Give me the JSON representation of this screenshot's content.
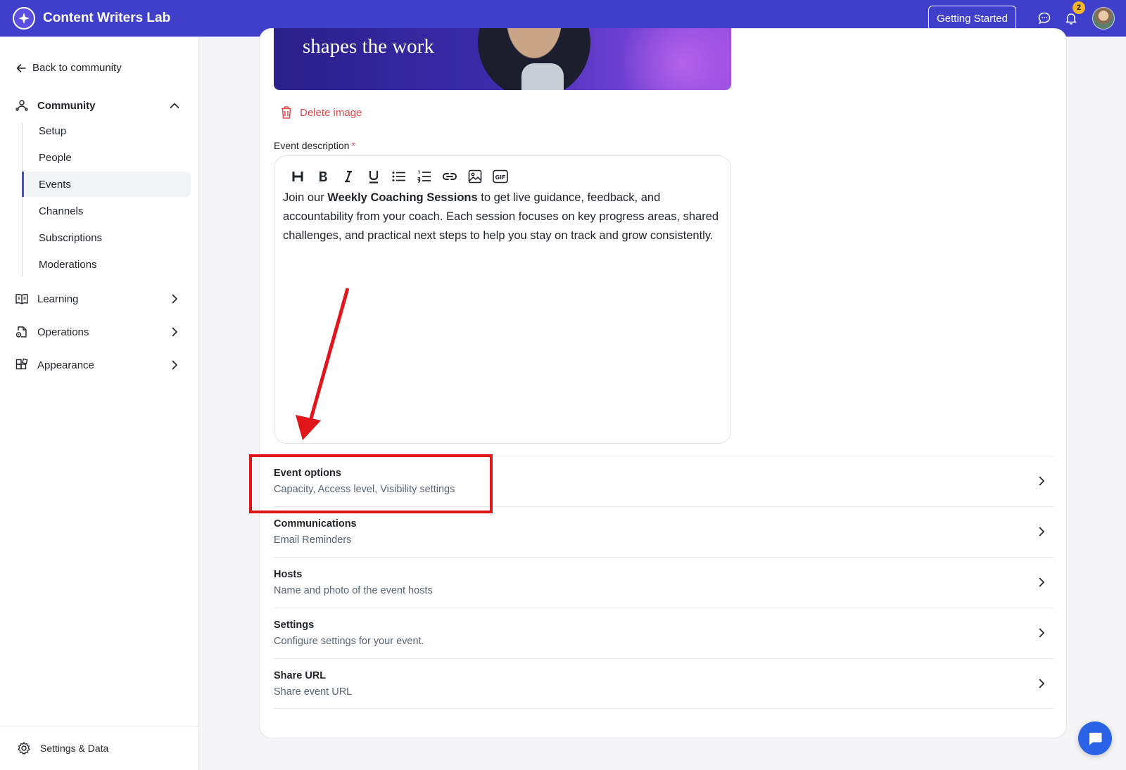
{
  "app": {
    "title": "Content Writers Lab",
    "getting_started": "Getting Started",
    "notification_count": "2"
  },
  "sidebar": {
    "back": "Back to community",
    "community": "Community",
    "community_items": [
      {
        "label": "Setup"
      },
      {
        "label": "People"
      },
      {
        "label": "Events",
        "active": true
      },
      {
        "label": "Channels"
      },
      {
        "label": "Subscriptions"
      },
      {
        "label": "Moderations"
      }
    ],
    "groups": [
      {
        "label": "Learning"
      },
      {
        "label": "Operations"
      },
      {
        "label": "Appearance"
      }
    ],
    "settings": "Settings & Data"
  },
  "banner": {
    "text": "shapes the work"
  },
  "delete_image": "Delete image",
  "description": {
    "label": "Event description",
    "required_mark": "*",
    "toolbar": [
      "heading-icon",
      "bold-icon",
      "italic-icon",
      "underline-icon",
      "bullet-list-icon",
      "numbered-list-icon",
      "link-icon",
      "image-icon",
      "gif-icon"
    ],
    "text_before": "Join our ",
    "text_bold": "Weekly Coaching Sessions",
    "text_after": " to get live guidance, feedback, and accountability from your coach. Each session focuses on key progress areas, shared challenges, and practical next steps to help you stay on track and grow consistently."
  },
  "options": [
    {
      "title": "Event options",
      "subtitle": "Capacity, Access level, Visibility settings"
    },
    {
      "title": "Communications",
      "subtitle": "Email Reminders"
    },
    {
      "title": "Hosts",
      "subtitle": "Name and photo of the event hosts"
    },
    {
      "title": "Settings",
      "subtitle": "Configure settings for your event."
    },
    {
      "title": "Share URL",
      "subtitle": "Share event URL"
    }
  ],
  "colors": {
    "topbar": "#3f3fcc",
    "accent": "#3b4fd8",
    "danger": "#e5484d",
    "annotation": "#e0161b",
    "badge": "#f5b62a"
  }
}
